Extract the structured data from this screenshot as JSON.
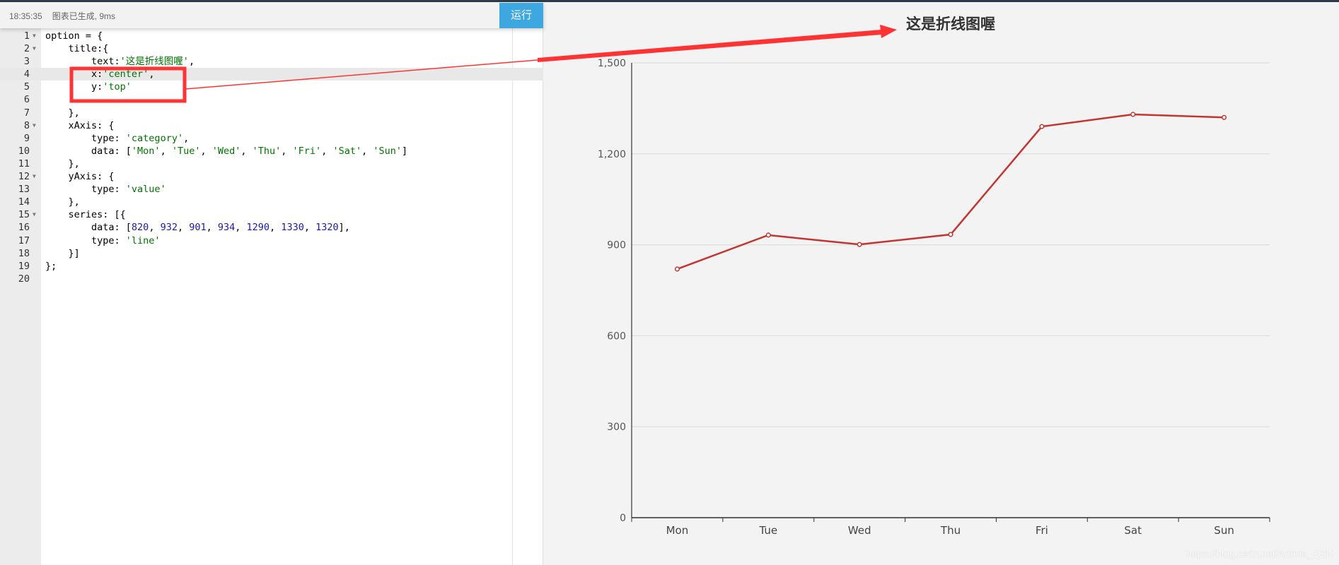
{
  "header": {
    "time": "18:35:35",
    "status": "图表已生成, 9ms",
    "run_label": "运行"
  },
  "editor": {
    "lines": [
      {
        "n": "1",
        "fold": true,
        "html": "option = {"
      },
      {
        "n": "2",
        "fold": true,
        "html": "    title:{"
      },
      {
        "n": "3",
        "fold": false,
        "html": "        text:<span class='s'>'这是折线图喔'</span>,"
      },
      {
        "n": "4",
        "fold": false,
        "html": "        x:<span class='s'>'center'</span>,",
        "active": true
      },
      {
        "n": "5",
        "fold": false,
        "html": "        y:<span class='s'>'top'</span>"
      },
      {
        "n": "6",
        "fold": false,
        "html": ""
      },
      {
        "n": "7",
        "fold": false,
        "html": "    },"
      },
      {
        "n": "8",
        "fold": true,
        "html": "    xAxis: {"
      },
      {
        "n": "9",
        "fold": false,
        "html": "        type: <span class='s'>'category'</span>,"
      },
      {
        "n": "10",
        "fold": false,
        "html": "        data: [<span class='s'>'Mon'</span>, <span class='s'>'Tue'</span>, <span class='s'>'Wed'</span>, <span class='s'>'Thu'</span>, <span class='s'>'Fri'</span>, <span class='s'>'Sat'</span>, <span class='s'>'Sun'</span>]"
      },
      {
        "n": "11",
        "fold": false,
        "html": "    },"
      },
      {
        "n": "12",
        "fold": true,
        "html": "    yAxis: {"
      },
      {
        "n": "13",
        "fold": false,
        "html": "        type: <span class='s'>'value'</span>"
      },
      {
        "n": "14",
        "fold": false,
        "html": "    },"
      },
      {
        "n": "15",
        "fold": true,
        "html": "    series: [{"
      },
      {
        "n": "16",
        "fold": false,
        "html": "        data: [<span class='n'>820</span>, <span class='n'>932</span>, <span class='n'>901</span>, <span class='n'>934</span>, <span class='n'>1290</span>, <span class='n'>1330</span>, <span class='n'>1320</span>],"
      },
      {
        "n": "17",
        "fold": false,
        "html": "        type: <span class='s'>'line'</span>"
      },
      {
        "n": "18",
        "fold": false,
        "html": "    }]"
      },
      {
        "n": "19",
        "fold": false,
        "html": "};"
      },
      {
        "n": "20",
        "fold": false,
        "html": ""
      }
    ]
  },
  "colors": {
    "series": "#c23531",
    "annotation": "#ff3333",
    "run": "#3fa7e0"
  },
  "chart_data": {
    "type": "line",
    "title": "这是折线图喔",
    "categories": [
      "Mon",
      "Tue",
      "Wed",
      "Thu",
      "Fri",
      "Sat",
      "Sun"
    ],
    "values": [
      820,
      932,
      901,
      934,
      1290,
      1330,
      1320
    ],
    "ylim": [
      0,
      1500
    ],
    "yticks": [
      0,
      300,
      600,
      900,
      1200,
      1500
    ],
    "ytick_labels": [
      "0",
      "300",
      "600",
      "900",
      "1,200",
      "1,500"
    ],
    "grid": true
  },
  "watermark": "https://blog.csdn.net/Artoria_QZH"
}
